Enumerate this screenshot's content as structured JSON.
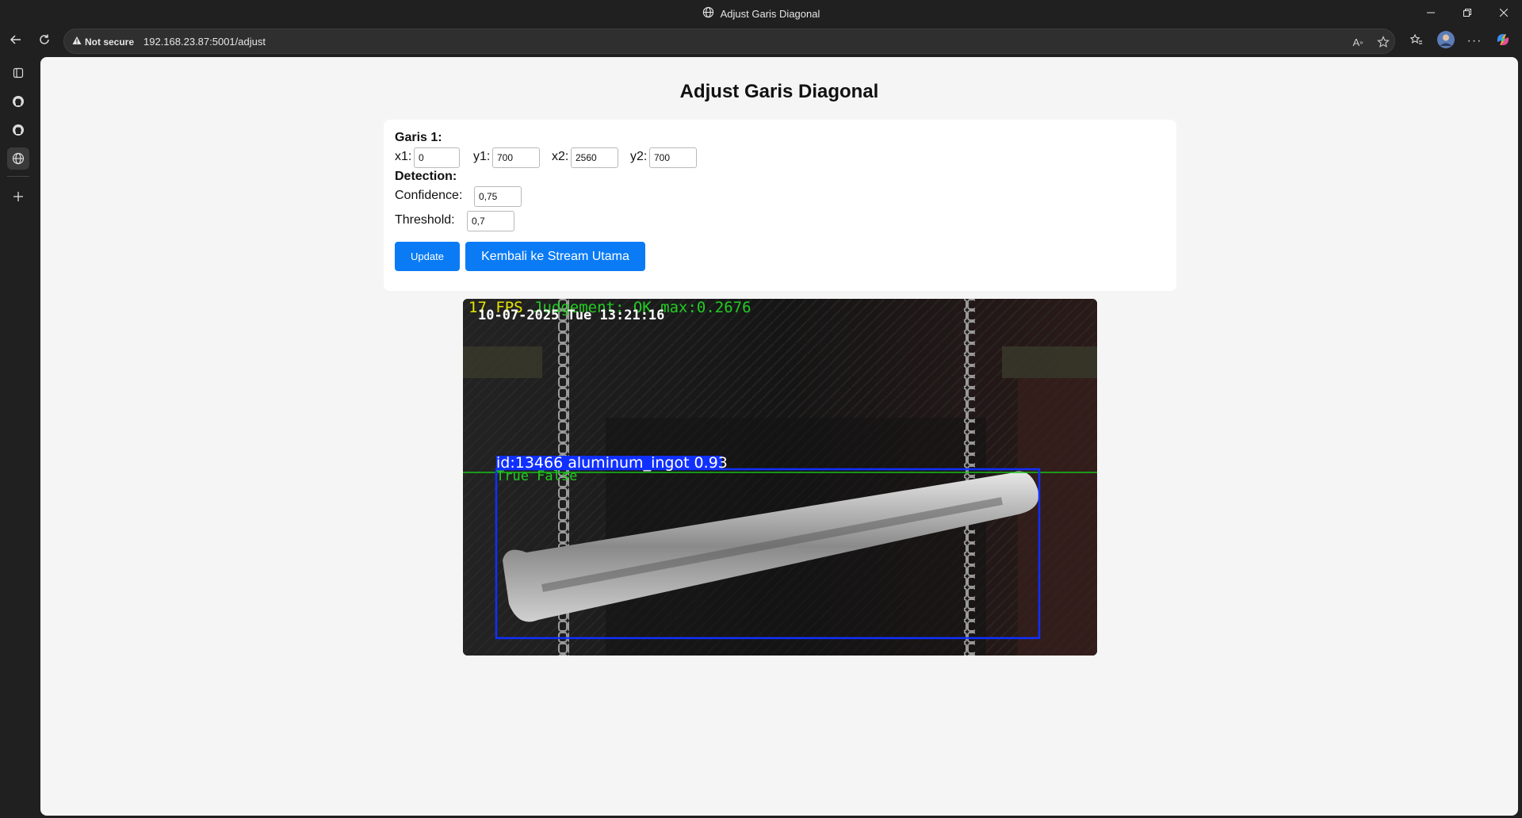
{
  "browser": {
    "tab_title": "Adjust Garis Diagonal",
    "security_label": "Not secure",
    "url": "192.168.23.87:5001/adjust"
  },
  "page": {
    "heading": "Adjust Garis Diagonal",
    "line_section_label": "Garis 1:",
    "fields": {
      "x1": {
        "label": "x1:",
        "value": "0"
      },
      "y1": {
        "label": "y1:",
        "value": "700"
      },
      "x2": {
        "label": "x2:",
        "value": "2560"
      },
      "y2": {
        "label": "y2:",
        "value": "700"
      }
    },
    "detection_label": "Detection:",
    "confidence": {
      "label": "Confidence:",
      "value": "0,75"
    },
    "threshold": {
      "label": "Threshold:",
      "value": "0,7"
    },
    "update_button": "Update",
    "back_button": "Kembali ke Stream Utama"
  },
  "stream": {
    "fps_text": "17 FPS",
    "judgement_text": "Judgement: OK max:0.2676",
    "timestamp": "10-07-2025 Tue 13:21:16",
    "detection_label": "id:13466 aluminum_ingot 0.93",
    "detection_status": "True False",
    "colors": {
      "fps": "#e6e600",
      "judgement": "#22cc22",
      "box": "#1030ff",
      "line": "#18c018"
    }
  },
  "icons": {
    "tab_icon": "globe-icon",
    "back": "arrow-left-icon",
    "reload": "reload-icon",
    "warning": "warning-icon",
    "read_aloud": "read-aloud-icon",
    "favorite": "star-icon",
    "favorites_list": "favorites-icon",
    "more": "ellipsis-icon",
    "copilot": "copilot-icon"
  },
  "accent_color": "#0a7bf5"
}
